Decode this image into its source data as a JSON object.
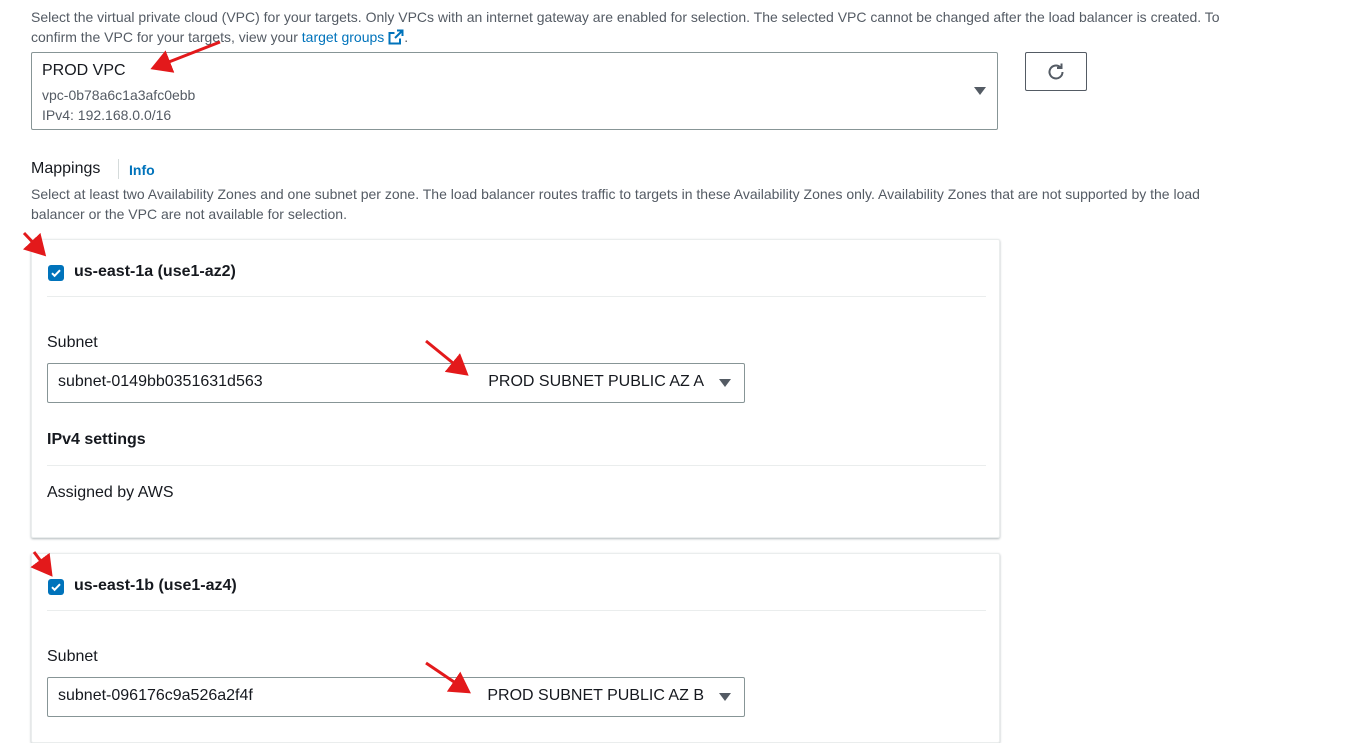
{
  "vpc_section": {
    "description_part1": "Select the virtual private cloud (VPC) for your targets. Only VPCs with an internet gateway are enabled for selection. The selected VPC cannot be changed after the load balancer is created. To",
    "description_part2": "confirm the VPC for your targets, view your ",
    "target_groups_link": "target groups",
    "description_end": ".",
    "selected_vpc": {
      "name": "PROD VPC",
      "id": "vpc-0b78a6c1a3afc0ebb",
      "cidr": "IPv4: 192.168.0.0/16"
    }
  },
  "mappings": {
    "title": "Mappings",
    "info_link": "Info",
    "description_line1": "Select at least two Availability Zones and one subnet per zone. The load balancer routes traffic to targets in these Availability Zones only. Availability Zones that are not supported by the load",
    "description_line2": "balancer or the VPC are not available for selection.",
    "zones": [
      {
        "label": "us-east-1a (use1-az2)",
        "checked": true,
        "subnet_label": "Subnet",
        "subnet_id": "subnet-0149bb0351631d563",
        "subnet_name": "PROD SUBNET PUBLIC AZ A",
        "ipv4_heading": "IPv4 settings",
        "ipv4_value": "Assigned by AWS"
      },
      {
        "label": "us-east-1b (use1-az4)",
        "checked": true,
        "subnet_label": "Subnet",
        "subnet_id": "subnet-096176c9a526a2f4f",
        "subnet_name": "PROD SUBNET PUBLIC AZ B"
      }
    ]
  },
  "icons": {
    "refresh": "refresh-icon",
    "external_link": "external-link-icon",
    "caret": "caret-down-icon",
    "checkmark": "checkmark-icon"
  },
  "colors": {
    "link": "#0073bb",
    "checkbox": "#0073bb",
    "annotation_arrow": "#e3191b"
  }
}
